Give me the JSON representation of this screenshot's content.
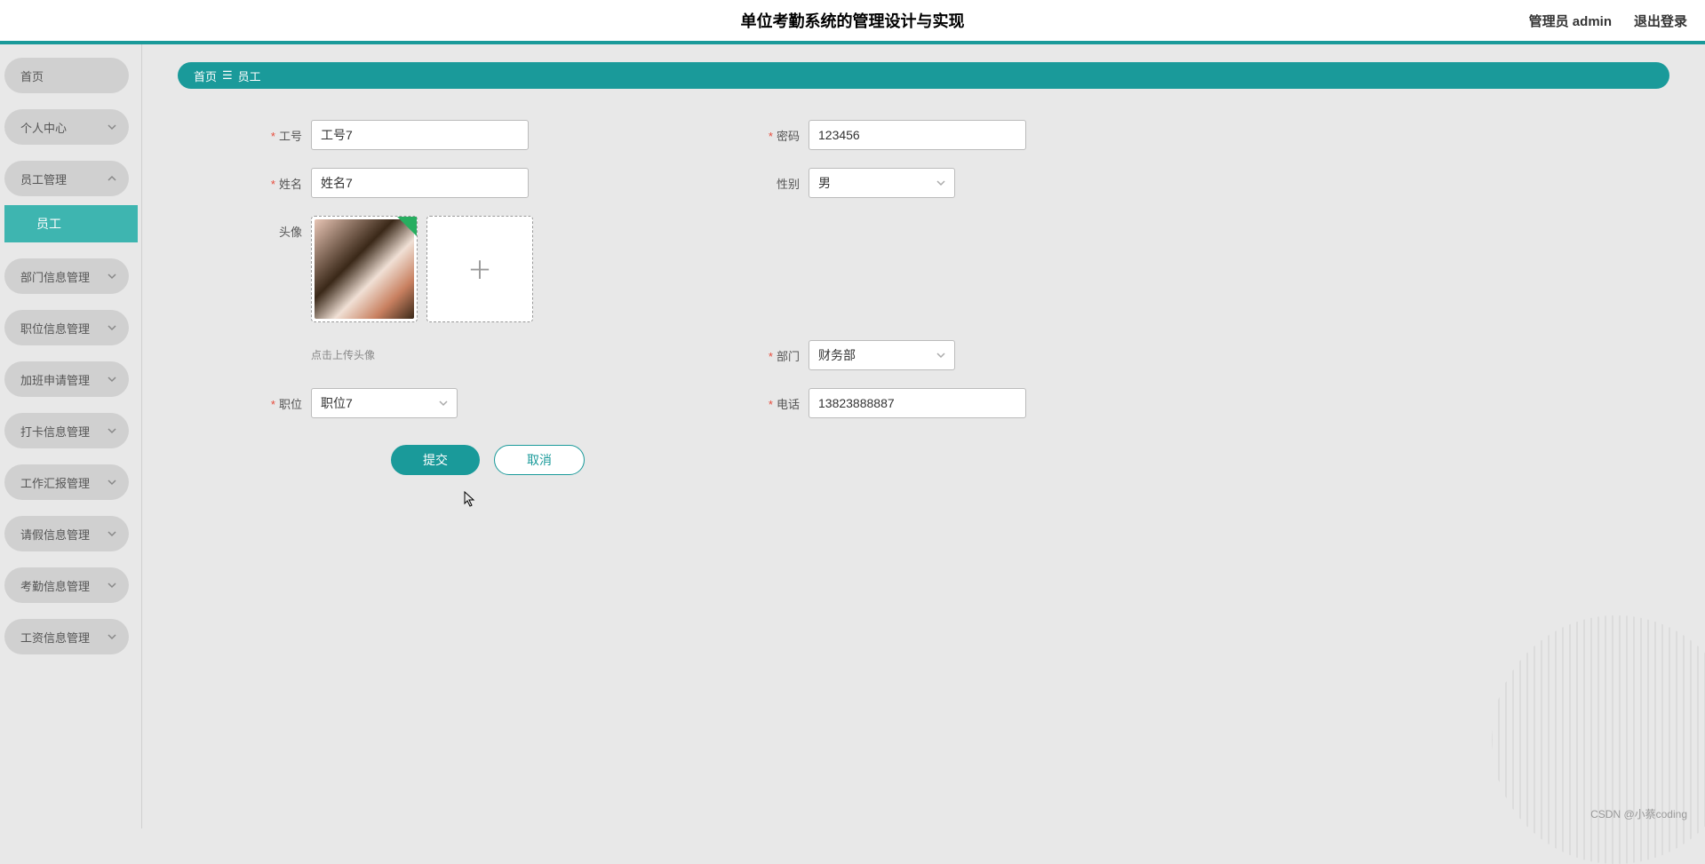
{
  "header": {
    "title": "单位考勤系统的管理设计与实现",
    "user_label": "管理员 admin",
    "logout": "退出登录"
  },
  "sidebar": {
    "items": [
      {
        "label": "首页",
        "chevron": false
      },
      {
        "label": "个人中心",
        "chevron": true
      },
      {
        "label": "员工管理",
        "chevron": true,
        "expanded": true,
        "sub": "员工"
      },
      {
        "label": "部门信息管理",
        "chevron": true
      },
      {
        "label": "职位信息管理",
        "chevron": true
      },
      {
        "label": "加班申请管理",
        "chevron": true
      },
      {
        "label": "打卡信息管理",
        "chevron": true
      },
      {
        "label": "工作汇报管理",
        "chevron": true
      },
      {
        "label": "请假信息管理",
        "chevron": true
      },
      {
        "label": "考勤信息管理",
        "chevron": true
      },
      {
        "label": "工资信息管理",
        "chevron": true
      }
    ]
  },
  "breadcrumb": {
    "home": "首页",
    "current": "员工"
  },
  "form": {
    "employee_no": {
      "label": "工号",
      "value": "工号7"
    },
    "password": {
      "label": "密码",
      "value": "123456"
    },
    "name": {
      "label": "姓名",
      "value": "姓名7"
    },
    "gender": {
      "label": "性别",
      "value": "男"
    },
    "avatar": {
      "label": "头像",
      "hint": "点击上传头像"
    },
    "department": {
      "label": "部门",
      "value": "财务部"
    },
    "position": {
      "label": "职位",
      "value": "职位7"
    },
    "phone": {
      "label": "电话",
      "value": "13823888887"
    }
  },
  "buttons": {
    "submit": "提交",
    "cancel": "取消"
  },
  "watermark": "CSDN @小蔡coding"
}
